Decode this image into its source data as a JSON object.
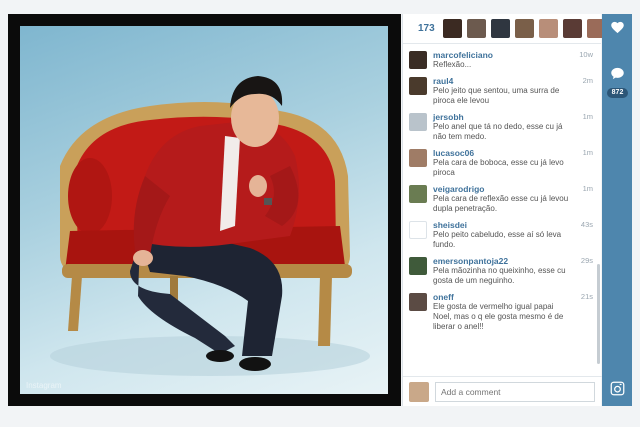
{
  "photo": {
    "watermark": "Instagram"
  },
  "likes": {
    "count": "173",
    "likers": [
      {
        "color": "#3b2a22"
      },
      {
        "color": "#6c5a4e"
      },
      {
        "color": "#2f3640"
      },
      {
        "color": "#7a5f49"
      },
      {
        "color": "#b88e79"
      },
      {
        "color": "#5a3b35"
      },
      {
        "color": "#9a6b59"
      }
    ]
  },
  "comments": [
    {
      "user": "marcofeliciano",
      "text": "Reflexão...",
      "time": "10w",
      "avatar_color": "#3a2c24"
    },
    {
      "user": "raul4",
      "text": "Pelo jeito que sentou, uma surra de piroca ele levou",
      "time": "2m",
      "avatar_color": "#4a3a2c"
    },
    {
      "user": "jersobh",
      "text": "Pelo anel que tá no dedo, esse cu já não tem medo.",
      "time": "1m",
      "avatar_color": "#b9c3cb"
    },
    {
      "user": "lucasoc06",
      "text": "Pela cara de boboca, esse cu já levo piroca",
      "time": "1m",
      "avatar_color": "#9f7c66"
    },
    {
      "user": "veigarodrigo",
      "text": "Pela cara de reflexão esse cu já levou dupla penetração.",
      "time": "1m",
      "avatar_color": "#6a7c52"
    },
    {
      "user": "sheisdei",
      "text": "Pelo peito cabeludo, esse aí só leva fundo.",
      "time": "43s",
      "avatar_color": "#ffffff"
    },
    {
      "user": "emersonpantoja22",
      "text": "Pela mãozinha no queixinho, esse cu gosta de um neguinho.",
      "time": "29s",
      "avatar_color": "#3f5a3a"
    },
    {
      "user": "oneff",
      "text": "Ele gosta de vermelho igual papai Noel, mas o q ele gosta mesmo é de liberar o anel!!",
      "time": "21s",
      "avatar_color": "#5b4b44"
    }
  ],
  "add_comment": {
    "placeholder": "Add a comment",
    "avatar_color": "#c9a889"
  },
  "sidebar": {
    "comment_count": "872"
  },
  "colors": {
    "accent": "#3f729b",
    "sidebar": "#4e86ad",
    "chair_red": "#c21a16",
    "chair_gold": "#c9a05a"
  }
}
